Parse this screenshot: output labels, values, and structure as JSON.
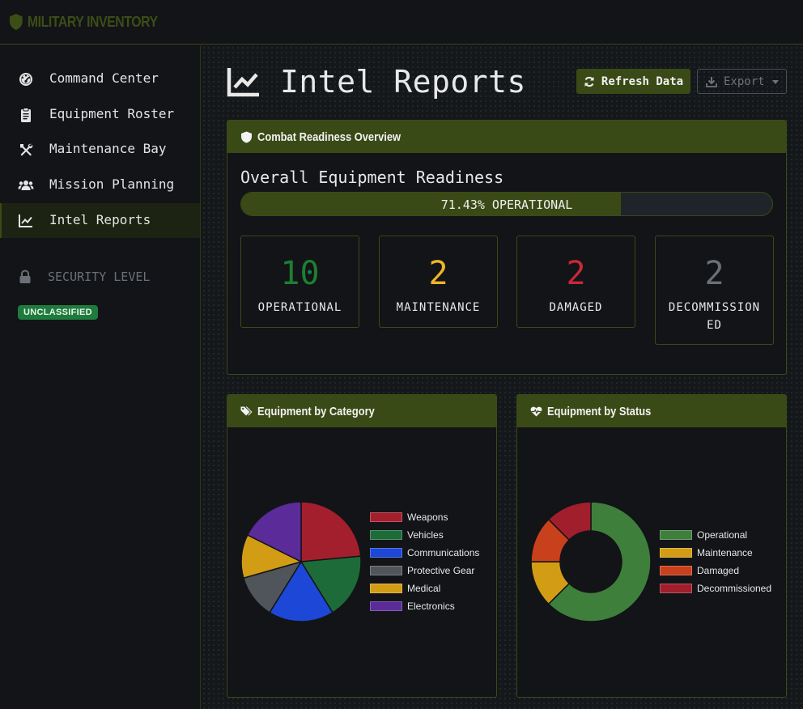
{
  "app": {
    "brand": "MILITARY INVENTORY"
  },
  "sidebar": {
    "items": [
      {
        "label": "Command Center",
        "icon": "tachometer-icon"
      },
      {
        "label": "Equipment Roster",
        "icon": "clipboard-icon"
      },
      {
        "label": "Maintenance Bay",
        "icon": "tools-icon"
      },
      {
        "label": "Mission Planning",
        "icon": "users-icon"
      },
      {
        "label": "Intel Reports",
        "icon": "chart-line-icon",
        "active": true
      }
    ],
    "security_label": "SECURITY LEVEL",
    "security_badge": "UNCLASSIFIED"
  },
  "header": {
    "title": "Intel Reports",
    "refresh_label": "Refresh Data",
    "export_label": "Export"
  },
  "readiness": {
    "card_title": "Combat Readiness Overview",
    "heading": "Overall Equipment Readiness",
    "progress_percent": 71.43,
    "progress_text": "71.43% OPERATIONAL",
    "stats": [
      {
        "value": "10",
        "label": "OPERATIONAL",
        "color": "#1e7e34"
      },
      {
        "value": "2",
        "label": "MAINTENANCE",
        "color": "#f0b429"
      },
      {
        "value": "2",
        "label": "DAMAGED",
        "color": "#c8283a"
      },
      {
        "value": "2",
        "label": "DECOMMISSIONED",
        "color": "#6b7078"
      }
    ]
  },
  "charts": {
    "category_title": "Equipment by Category",
    "status_title": "Equipment by Status"
  },
  "chart_data": [
    {
      "type": "pie",
      "categories": [
        "Weapons",
        "Vehicles",
        "Communications",
        "Protective Gear",
        "Medical",
        "Electronics"
      ],
      "values": [
        4,
        3,
        3,
        2,
        2,
        3
      ],
      "colors": [
        "#a41f2e",
        "#1e6b3a",
        "#1d47d6",
        "#4f555a",
        "#d29d14",
        "#5a2b99"
      ],
      "legend_position": "right"
    },
    {
      "type": "pie",
      "donut": true,
      "categories": [
        "Operational",
        "Maintenance",
        "Damaged",
        "Decommissioned"
      ],
      "values": [
        10,
        2,
        2,
        2
      ],
      "colors": [
        "#3f7f3c",
        "#d29d14",
        "#c9401c",
        "#a11e2c"
      ],
      "legend_position": "right"
    }
  ]
}
